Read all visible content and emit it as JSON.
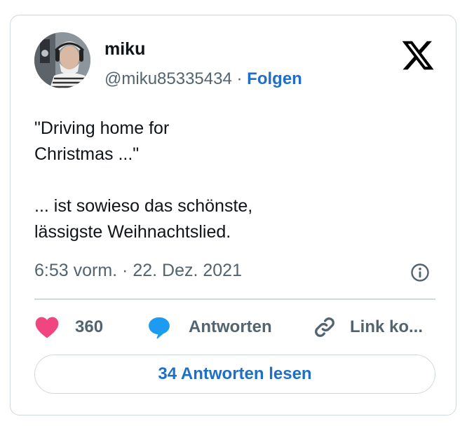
{
  "author": {
    "name": "miku",
    "handle": "@miku85335434",
    "separator": "·",
    "follow_label": "Folgen"
  },
  "tweet": {
    "lines": [
      "\"Driving home for",
      "Christmas ...\"",
      "",
      "... ist sowieso das schönste,",
      "lässigste Weihnachtslied."
    ]
  },
  "timestamp": "6:53 vorm. · 22. Dez. 2021",
  "actions": {
    "like_count": "360",
    "reply_label": "Antworten",
    "link_label": "Link ko..."
  },
  "read_replies_label": "34 Antworten lesen",
  "icons": {
    "platform": "x-logo-icon",
    "info": "info-icon",
    "like": "heart-icon",
    "reply": "speech-bubble-icon",
    "link": "link-icon"
  },
  "colors": {
    "accent": "#1d6fc8",
    "like": "#f0457f",
    "reply": "#1d9bf0",
    "muted": "#536471",
    "border": "#cfd9de"
  }
}
